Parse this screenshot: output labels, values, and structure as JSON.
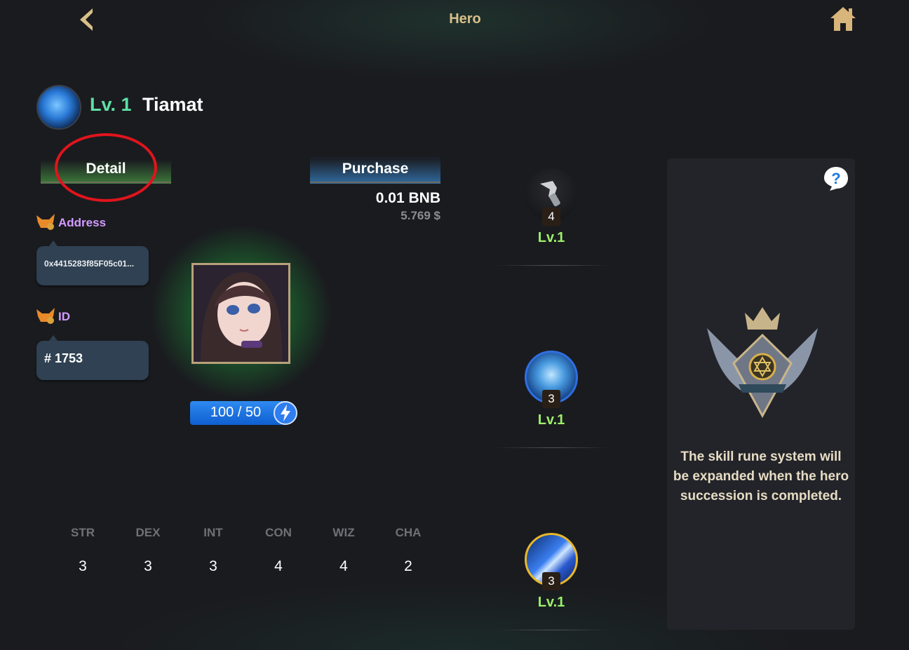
{
  "header": {
    "title": "Hero"
  },
  "hero": {
    "level": "Lv. 1",
    "name": "Tiamat"
  },
  "tabs": {
    "detail": "Detail",
    "purchase": "Purchase"
  },
  "price": {
    "bnb": "0.01 BNB",
    "usd": "5.769 $"
  },
  "address": {
    "label": "Address",
    "value": "0x4415283f85F05c01..."
  },
  "id": {
    "label": "ID",
    "value": "# 1753"
  },
  "energy": {
    "text": "100 / 50",
    "current": 100,
    "max": 50
  },
  "stats": [
    {
      "name": "STR",
      "value": "3"
    },
    {
      "name": "DEX",
      "value": "3"
    },
    {
      "name": "INT",
      "value": "3"
    },
    {
      "name": "CON",
      "value": "4"
    },
    {
      "name": "WIZ",
      "value": "4"
    },
    {
      "name": "CHA",
      "value": "2"
    }
  ],
  "skills": [
    {
      "icon": "dagger-icon",
      "count": "4",
      "level": "Lv.1"
    },
    {
      "icon": "water-orb-icon",
      "count": "3",
      "level": "Lv.1"
    },
    {
      "icon": "slash-icon",
      "count": "3",
      "level": "Lv.1"
    }
  ],
  "rune_panel": {
    "message": "The skill rune system will be expanded when the hero succession is completed."
  },
  "colors": {
    "level_green": "#5ee0a6",
    "skill_level_green": "#9cf06a",
    "label_purple": "#d39bff",
    "annotation_red": "#e0141c",
    "title_gold": "#d8c08a"
  }
}
